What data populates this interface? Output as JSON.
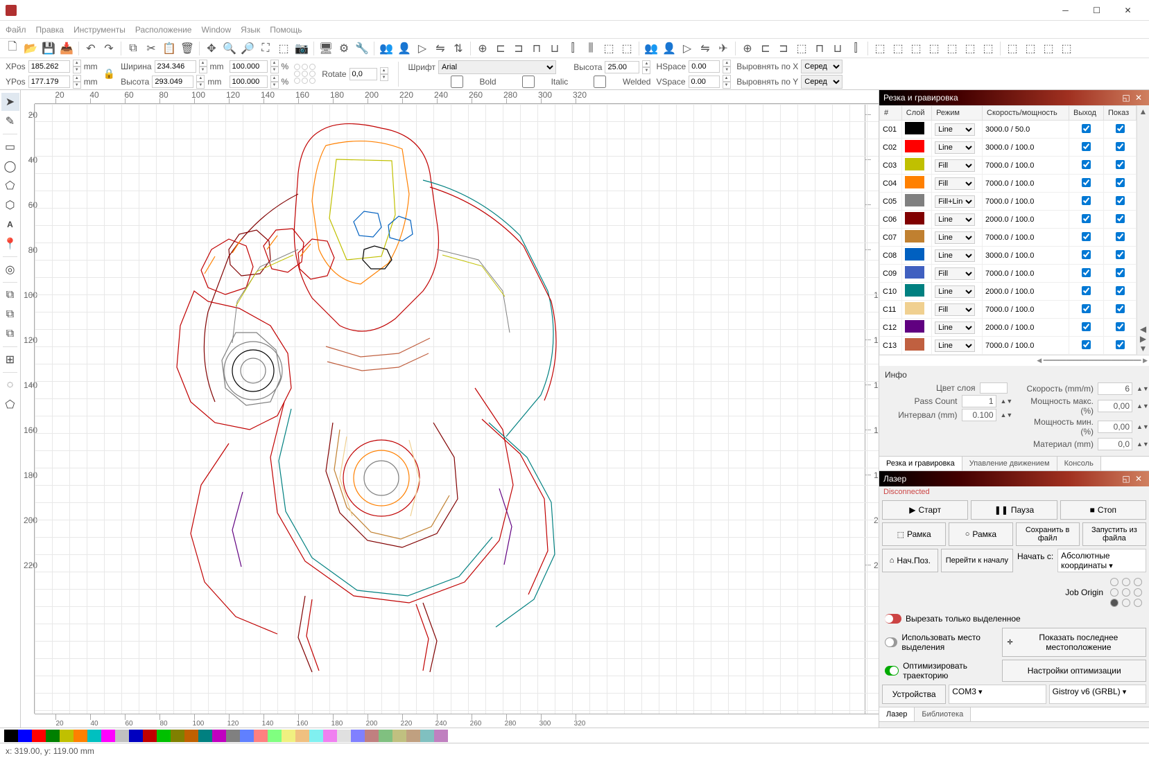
{
  "menubar": [
    "Файл",
    "Правка",
    "Инструменты",
    "Расположение",
    "Window",
    "Язык",
    "Помощь"
  ],
  "propbar": {
    "xpos_label": "XPos",
    "xpos": "185.262",
    "ypos_label": "YPos",
    "ypos": "177.179",
    "width_label": "Ширина",
    "width": "234.346",
    "height_label": "Высота",
    "height": "293.049",
    "mm": "mm",
    "pct": "%",
    "pct_val1": "100.000",
    "pct_val2": "100.000",
    "rotate_label": "Rotate",
    "rotate": "0,0",
    "font_label": "Шрифт",
    "font": "Arial",
    "height2_label": "Высота",
    "height2": "25.00",
    "bold": "Bold",
    "italic": "Italic",
    "welded": "Welded",
    "hspace_label": "HSpace",
    "hspace": "0.00",
    "vspace_label": "VSpace",
    "vspace": "0.00",
    "align_x": "Выровнять по X",
    "align_y": "Выровнять по Y",
    "align_val": "Серед"
  },
  "cuts_panel": {
    "title": "Резка и гравировка",
    "headers": [
      "#",
      "Слой",
      "Режим",
      "Скорость/мощность",
      "Выход",
      "Показ"
    ],
    "rows": [
      {
        "id": "C01",
        "color": "#000000",
        "mode": "Line",
        "sp": "3000.0 / 50.0"
      },
      {
        "id": "C02",
        "color": "#ff0000",
        "mode": "Line",
        "sp": "3000.0 / 100.0"
      },
      {
        "id": "C03",
        "color": "#c0c000",
        "mode": "Fill",
        "sp": "7000.0 / 100.0"
      },
      {
        "id": "C04",
        "color": "#ff8000",
        "mode": "Fill",
        "sp": "7000.0 / 100.0"
      },
      {
        "id": "C05",
        "color": "#808080",
        "mode": "Fill+Line",
        "sp": "7000.0 / 100.0"
      },
      {
        "id": "C06",
        "color": "#800000",
        "mode": "Line",
        "sp": "2000.0 / 100.0"
      },
      {
        "id": "C07",
        "color": "#c08030",
        "mode": "Line",
        "sp": "7000.0 / 100.0"
      },
      {
        "id": "C08",
        "color": "#0060c0",
        "mode": "Line",
        "sp": "3000.0 / 100.0"
      },
      {
        "id": "C09",
        "color": "#4060c0",
        "mode": "Fill",
        "sp": "7000.0 / 100.0"
      },
      {
        "id": "C10",
        "color": "#008080",
        "mode": "Line",
        "sp": "2000.0 / 100.0"
      },
      {
        "id": "C11",
        "color": "#f0d090",
        "mode": "Fill",
        "sp": "7000.0 / 100.0"
      },
      {
        "id": "C12",
        "color": "#600080",
        "mode": "Line",
        "sp": "2000.0 / 100.0"
      },
      {
        "id": "C13",
        "color": "#c06040",
        "mode": "Line",
        "sp": "7000.0 / 100.0"
      }
    ]
  },
  "info": {
    "title": "Инфо",
    "layer_color": "Цвет слоя",
    "speed": "Скорость (mm/m)",
    "speed_val": "6",
    "pass_count": "Pass Count",
    "pass_val": "1",
    "power_max": "Мощность макс. (%)",
    "power_max_val": "0,00",
    "interval": "Интервал (mm)",
    "interval_val": "0.100",
    "power_min": "Мощность мин. (%)",
    "power_min_val": "0,00",
    "material": "Материал (mm)",
    "material_val": "0,0"
  },
  "tabs1": [
    "Резка и гравировка",
    "Упавление движением",
    "Консоль"
  ],
  "laser": {
    "title": "Лазер",
    "disconnected": "Disconnected",
    "start": "Старт",
    "pause": "Пауза",
    "stop": "Стоп",
    "frame1": "Рамка",
    "frame2": "Рамка",
    "save": "Сохранить в файл",
    "run_file": "Запустить из файла",
    "home": "Нач.Поз.",
    "goto": "Перейти к началу",
    "start_from": "Начать с:",
    "start_from_val": "Абсолютные координаты",
    "job_origin": "Job Origin",
    "cut_sel": "Вырезать только выделенное",
    "use_sel": "Использовать место выделения",
    "show_last": "Показать последнее местоположение",
    "optimize": "Оптимизировать траекторию",
    "opt_settings": "Настройки оптимизации",
    "devices": "Устройства",
    "port": "COM3",
    "device": "Gistroy v6 (GRBL)"
  },
  "tabs2": [
    "Лазер",
    "Библиотека"
  ],
  "palette": [
    "#000000",
    "#0000ff",
    "#ff0000",
    "#008000",
    "#c0c000",
    "#ff8000",
    "#00c0c0",
    "#ff00ff",
    "#c0c0c0",
    "#0000c0",
    "#c00000",
    "#00c000",
    "#808000",
    "#c06000",
    "#008080",
    "#c000c0",
    "#808080",
    "#6080ff",
    "#ff8080",
    "#80ff80",
    "#f0f080",
    "#f0c080",
    "#80f0f0",
    "#f080f0",
    "#e0e0e0",
    "#8080ff",
    "#c08080",
    "#80c080",
    "#c0c080",
    "#c0a080",
    "#80c0c0",
    "#c080c0"
  ],
  "statusbar": "x: 319.00, y: 119.00 mm",
  "ruler_ticks": [
    20,
    40,
    60,
    80,
    100,
    120,
    140,
    160,
    180,
    200,
    220,
    240,
    260,
    280,
    300,
    320
  ]
}
